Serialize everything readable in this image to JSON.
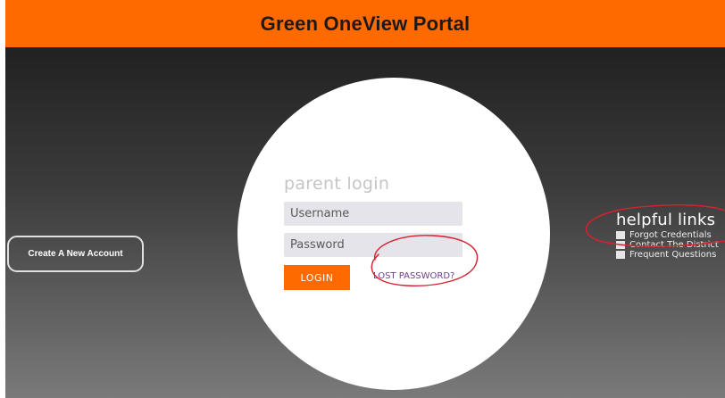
{
  "header": {
    "title": "Green OneView Portal"
  },
  "login": {
    "title": "parent login",
    "username_placeholder": "Username",
    "password_placeholder": "Password",
    "login_label": "LOGIN",
    "lost_password_label": "LOST PASSWORD?"
  },
  "create_account": {
    "label": "Create A New Account"
  },
  "helpful_links": {
    "title": "helpful links",
    "items": [
      {
        "label": "Forgot Credentials",
        "icon": "checkbox-icon"
      },
      {
        "label": "Contact The District",
        "icon": "checkbox-icon"
      },
      {
        "label": "Frequent Questions",
        "icon": "checkbox-icon"
      }
    ]
  },
  "colors": {
    "accent": "#ff6a00",
    "background_top": "#212121",
    "background_bottom": "#7a7a7a",
    "link": "#6b3e8c",
    "annotation": "#d9202e"
  }
}
